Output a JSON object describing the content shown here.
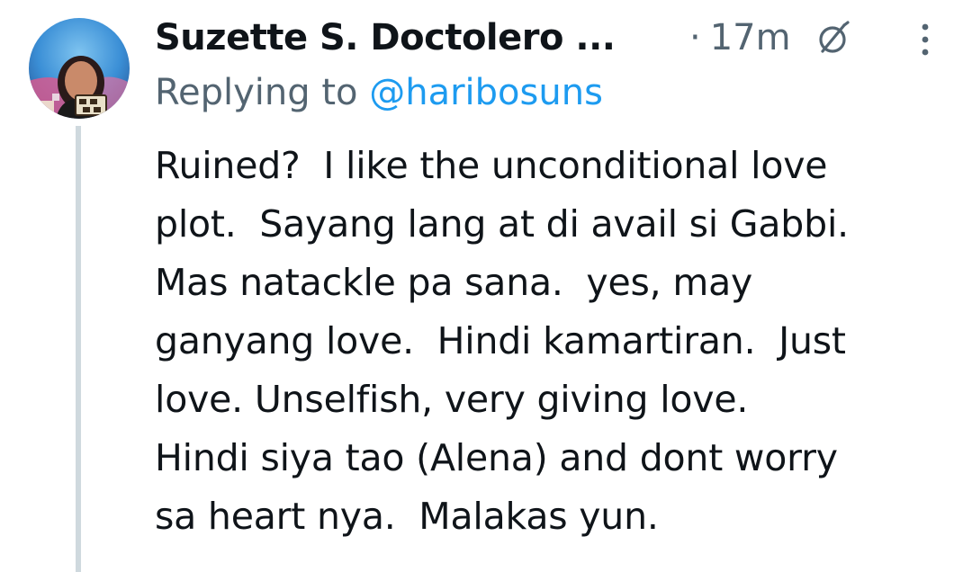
{
  "tweet": {
    "author": {
      "display_name": "Suzette S. Doctolero ...",
      "avatar_icon": "user-avatar"
    },
    "meta": {
      "separator": "·",
      "time": "17m",
      "edited_icon": "edited-icon",
      "more_icon": "more-options-icon"
    },
    "replying": {
      "prefix": "Replying to ",
      "handle": "@haribosuns"
    },
    "body_lines": [
      "Ruined?  I like the unconditional love",
      "plot.  Sayang lang at di avail si Gabbi.",
      "Mas natackle pa sana.  yes, may",
      "ganyang love.  Hindi kamartiran.  Just",
      "love. Unselfish, very giving love.",
      "Hindi siya tao (Alena) and dont worry",
      "sa heart nya.  Malakas yun."
    ]
  },
  "colors": {
    "text_primary": "#0f1419",
    "text_secondary": "#536471",
    "link": "#1d9bf0",
    "thread_line": "#cfd9de"
  }
}
